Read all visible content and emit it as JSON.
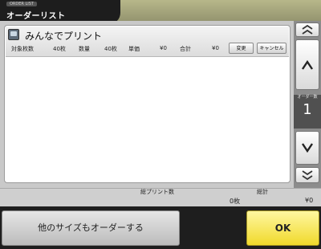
{
  "header": {
    "subtitle": "ORDER LIST",
    "title": "オーダーリスト"
  },
  "order_list": {
    "items": [
      {
        "name": "みんなでプリント",
        "target_count_label": "対象枚数",
        "target_count": "40枚",
        "quantity_label": "数量",
        "quantity": "40枚",
        "unit_price_label": "単価",
        "unit_price": "¥0",
        "total_label": "合計",
        "total": "¥0",
        "change_button": "変更",
        "cancel_button": "キャンセル"
      }
    ]
  },
  "scroller": {
    "order_count_label": "オーダー数",
    "order_count": "1"
  },
  "totals": {
    "total_prints_label": "総プリント数",
    "total_prints": "0枚",
    "sum_label": "総計",
    "sum": "¥0"
  },
  "actions": {
    "other_sizes_button": "他のサイズもオーダーする",
    "ok_button": "OK"
  },
  "icons": {
    "print": "print-set-icon",
    "scroll_top": "double-up-arrow-icon",
    "scroll_up": "up-arrow-icon",
    "scroll_down": "down-arrow-icon",
    "scroll_bottom": "double-down-arrow-icon"
  },
  "colors": {
    "ok_button": "#f0d92b",
    "header_bg": "#1d1d1d",
    "background": "#3a3a3a"
  }
}
